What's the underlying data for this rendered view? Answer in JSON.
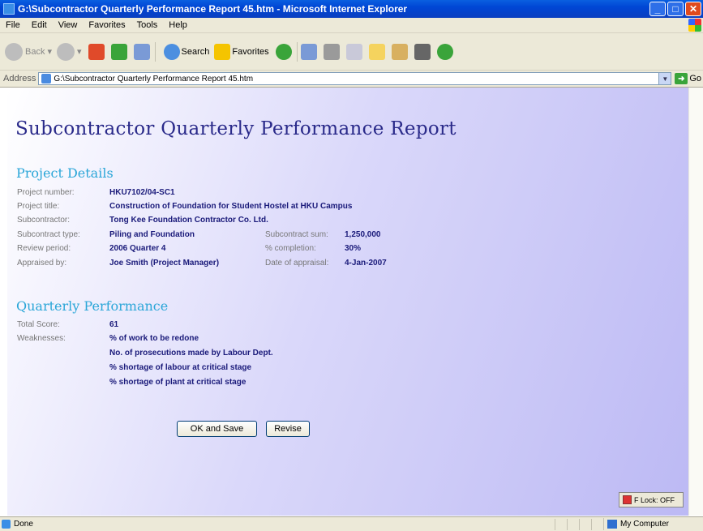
{
  "window": {
    "title": "G:\\Subcontractor Quarterly Performance Report 45.htm - Microsoft Internet Explorer"
  },
  "menu": [
    "File",
    "Edit",
    "View",
    "Favorites",
    "Tools",
    "Help"
  ],
  "toolbar": {
    "back": "Back",
    "search": "Search",
    "favorites": "Favorites"
  },
  "address": {
    "label": "Address",
    "value": "G:\\Subcontractor Quarterly Performance Report 45.htm",
    "go": "Go"
  },
  "report": {
    "title": "Subcontractor Quarterly Performance Report",
    "project_details_title": "Project Details",
    "project_number_label": "Project number:",
    "project_number": "HKU7102/04-SC1",
    "project_title_label": "Project title:",
    "project_title": "Construction of Foundation for Student Hostel at HKU Campus",
    "subcontractor_label": "Subcontractor:",
    "subcontractor": "Tong Kee Foundation Contractor Co. Ltd.",
    "subcontract_type_label": "Subcontract type:",
    "subcontract_type": "Piling and Foundation",
    "subcontract_sum_label": "Subcontract sum:",
    "subcontract_sum": "1,250,000",
    "review_period_label": "Review period:",
    "review_period": "2006 Quarter 4",
    "completion_label": "% completion:",
    "completion": "30%",
    "appraised_by_label": "Appraised by:",
    "appraised_by": "Joe Smith (Project Manager)",
    "date_of_appraisal_label": "Date of appraisal:",
    "date_of_appraisal": "4-Jan-2007",
    "quarterly_performance_title": "Quarterly Performance",
    "total_score_label": "Total Score:",
    "total_score": "61",
    "weaknesses_label": "Weaknesses:",
    "weaknesses": [
      "% of work to be redone",
      "No. of prosecutions made by Labour Dept.",
      "% shortage of labour at critical stage",
      "% shortage of plant at critical stage"
    ],
    "ok_save_label": "OK and Save",
    "revise_label": "Revise"
  },
  "flock": "F Lock: OFF",
  "status": {
    "text": "Done",
    "zone": "My Computer"
  }
}
